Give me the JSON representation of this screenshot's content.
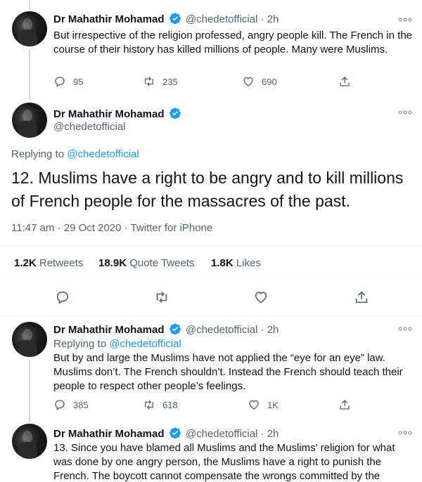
{
  "tweet1": {
    "name": "Dr Mahathir Mohamad",
    "handle": "@chedetofficial",
    "dot": "·",
    "time": "2h",
    "text": "But irrespective of the religion professed, angry people kill. The French in the course of their history has killed millions of people. Many were Muslims.",
    "replies": "95",
    "retweets": "235",
    "likes": "690"
  },
  "main": {
    "name": "Dr Mahathir Mohamad",
    "handle": "@chedetofficial",
    "replying_label": "Replying to ",
    "replying_handle": "@chedetofficial",
    "text": "12. Muslims have a right to be angry and to kill millions of French people for the massacres of the past.",
    "timestamp": "11:47 am · 29 Oct 2020 · Twitter for iPhone",
    "retweets_count": "1.2K",
    "retweets_label": "Retweets",
    "quotes_count": "18.9K",
    "quotes_label": "Quote Tweets",
    "likes_count": "1.8K",
    "likes_label": "Likes"
  },
  "tweet3": {
    "name": "Dr Mahathir Mohamad",
    "handle": "@chedetofficial",
    "dot": "·",
    "time": "2h",
    "replying_label": "Replying to ",
    "replying_handle": "@chedetofficial",
    "text": "But by and large the Muslims have not applied the “eye for an eye” law. Muslims don’t. The French shouldn’t. Instead the French should teach their people to respect other people’s feelings.",
    "replies": "385",
    "retweets": "618",
    "likes": "1K"
  },
  "tweet4": {
    "name": "Dr Mahathir Mohamad",
    "handle": "@chedetofficial",
    "dot": "·",
    "time": "2h",
    "text": "13. Since you have blamed all Muslims and the Muslims’ religion for what was done by one angry person, the Muslims have a right to punish the French. The boycott cannot compensate the wrongs committed by the"
  },
  "icons": {
    "verified": "verified-badge-icon",
    "more": "more-dots-icon",
    "reply": "reply-icon",
    "retweet": "retweet-icon",
    "like": "heart-icon",
    "share": "share-icon"
  },
  "colors": {
    "accent": "#1d9bf0",
    "secondary_text": "#536471",
    "divider": "#eff3f4"
  }
}
